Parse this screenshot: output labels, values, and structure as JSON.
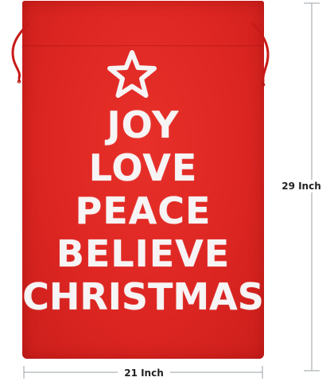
{
  "product": {
    "bag_color": "#dd2622",
    "print_color": "#f6f4f4",
    "words": [
      "JOY",
      "LOVE",
      "PEACE",
      "BELIEVE",
      "CHRISTMAS"
    ],
    "star_icon": "star-outline-icon"
  },
  "dimensions": {
    "height_label": "29 Inch",
    "width_label": "21 Inch"
  }
}
